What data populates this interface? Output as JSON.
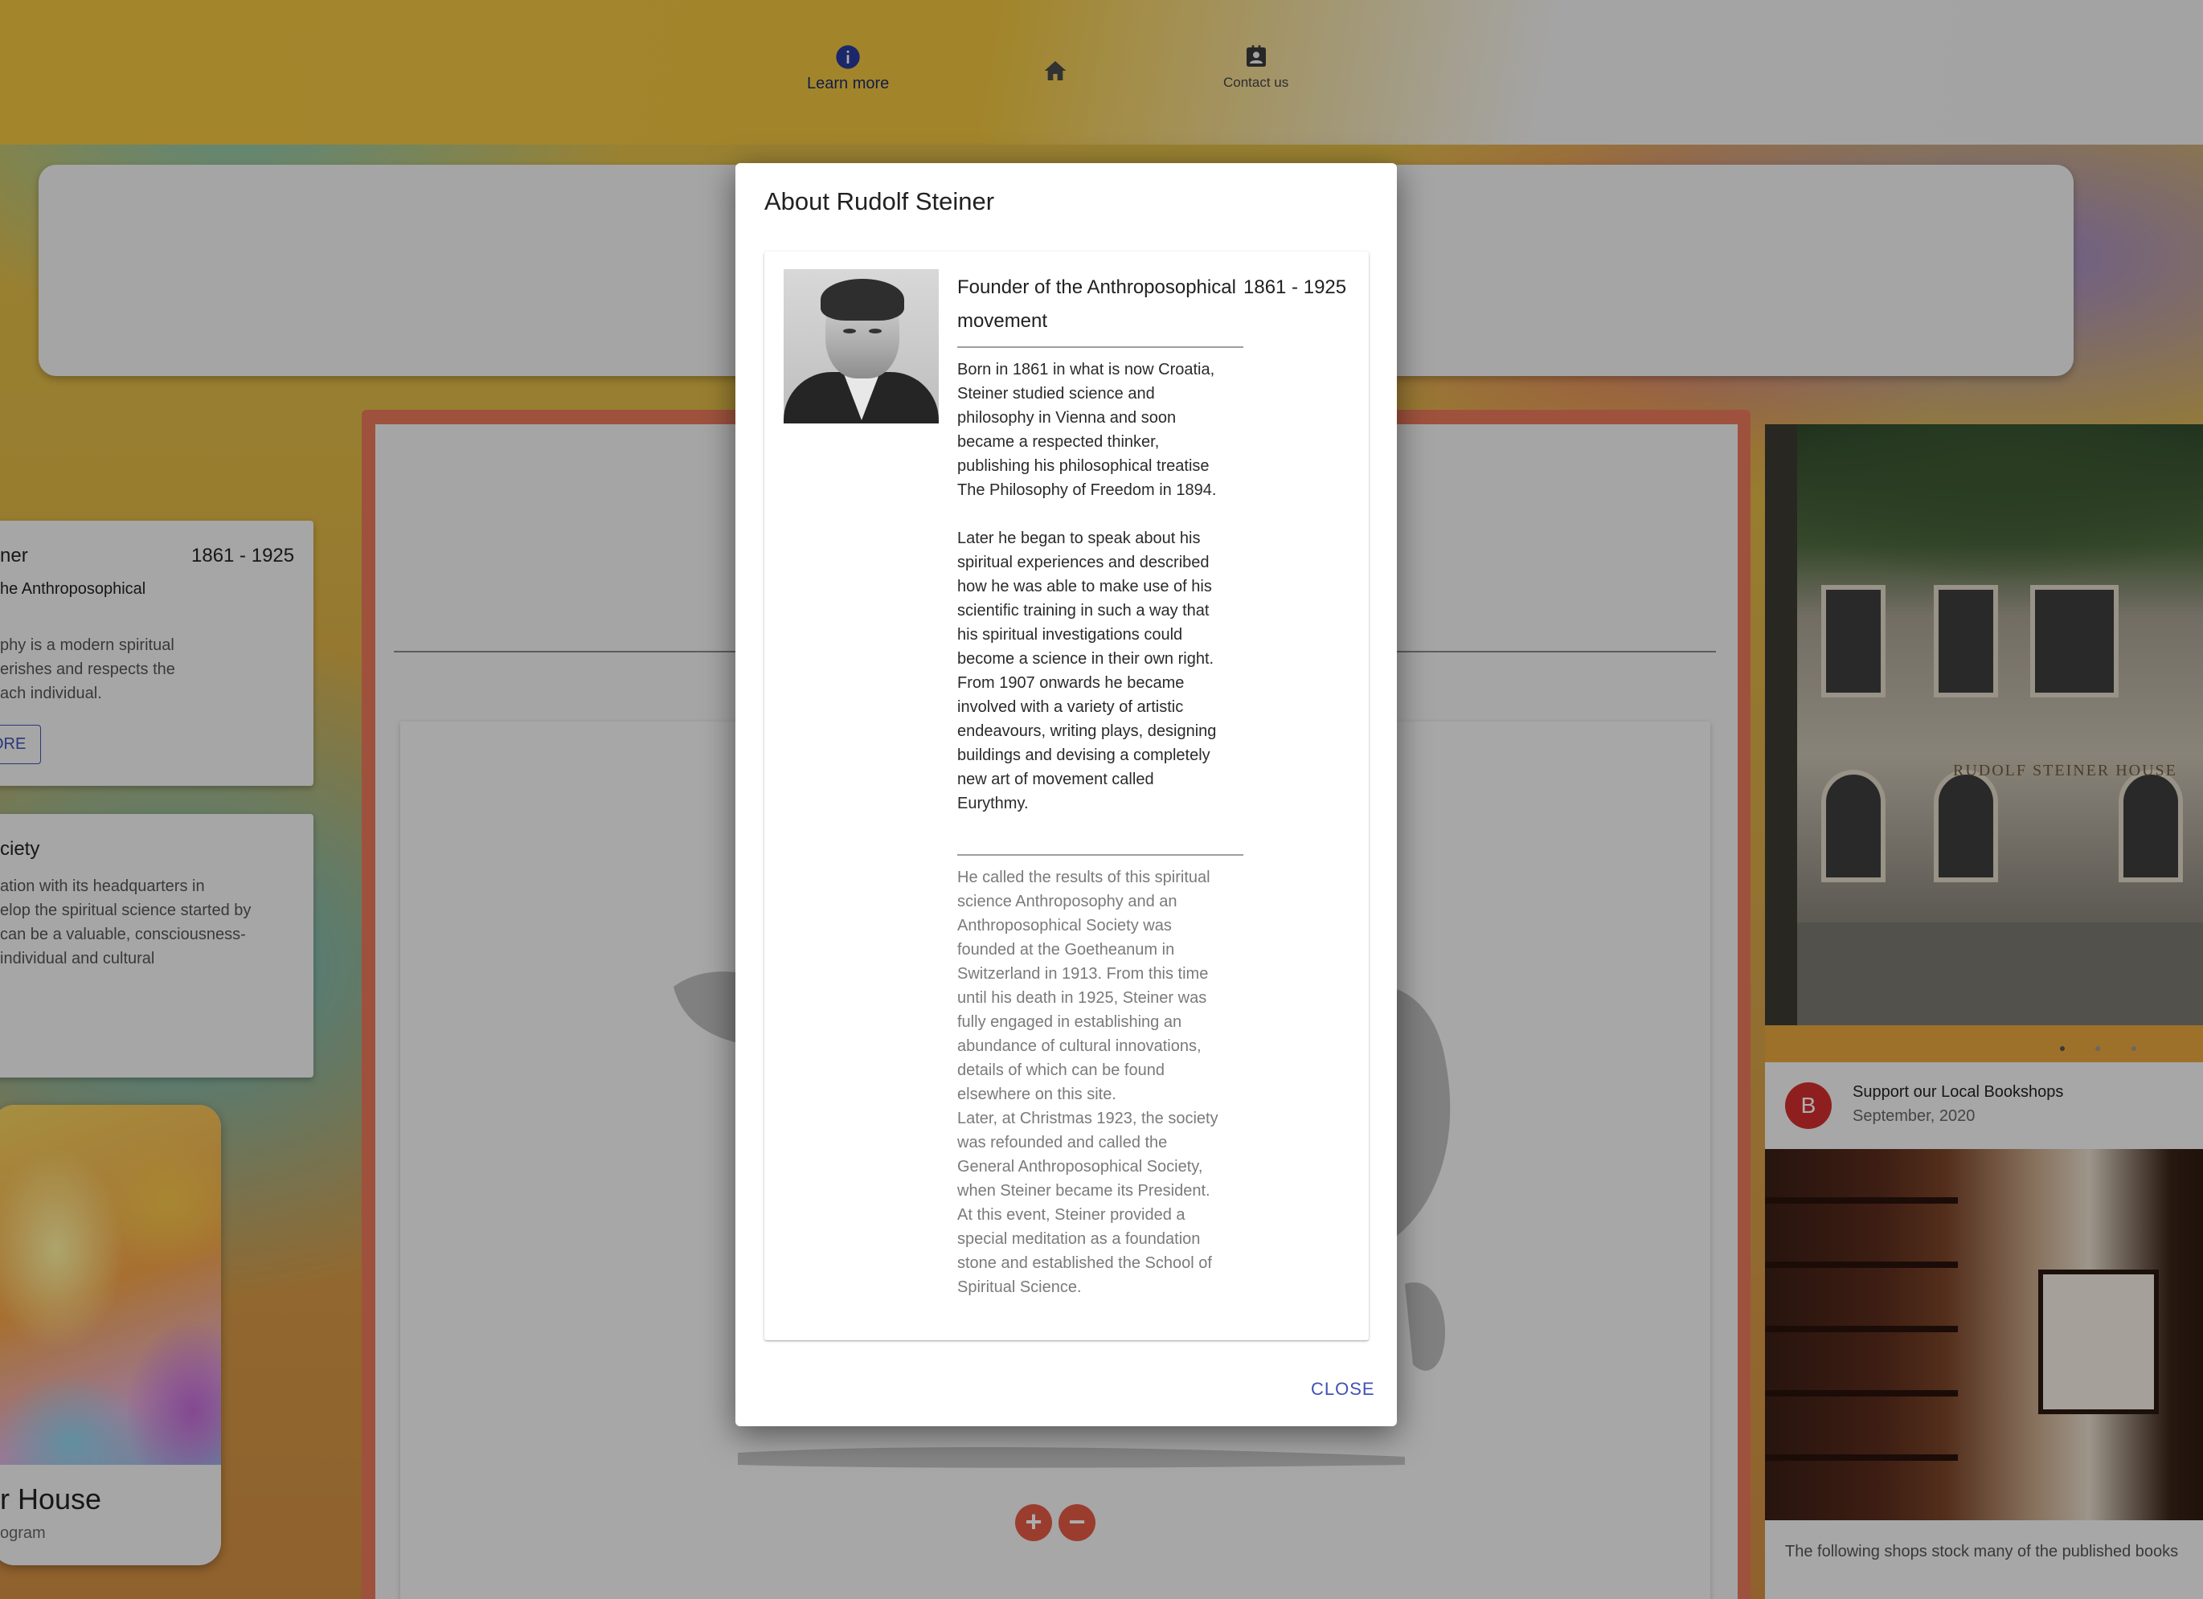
{
  "nav": {
    "items": [
      {
        "label": "Learn more",
        "icon": "info-icon"
      },
      {
        "label": "",
        "icon": "home-icon"
      },
      {
        "label": "Contact us",
        "icon": "contact-card-icon"
      }
    ]
  },
  "background": {
    "side_card_1": {
      "title": "ner",
      "years": "1861 - 1925",
      "subtitle": "he Anthroposophical",
      "text": [
        "phy is a modern spiritual",
        "erishes and respects the",
        "ach individual."
      ],
      "button": "ORE"
    },
    "side_card_2": {
      "title": "ciety",
      "text": [
        "ation with its headquarters in",
        "elop the spiritual science started by",
        "can be a valuable, consciousness-",
        "individual and cultural"
      ]
    },
    "art_card": {
      "title": "r House",
      "subtitle": "ogram"
    },
    "zoom": {
      "plus": "+",
      "minus": "−"
    },
    "building_sign": "RUDOLF STEINER HOUSE",
    "news": {
      "avatar_letter": "B",
      "title": "Support our Local Bookshops",
      "date": "September, 2020",
      "text": "The following shops stock many of the published books"
    }
  },
  "dialog": {
    "title": "About Rudolf Steiner",
    "heading": "Founder of the Anthroposophical movement",
    "years": "1861 - 1925",
    "paragraph_1": "Born in 1861 in what is now Croatia,\nSteiner studied science and\nphilosophy in Vienna and soon\nbecame a respected thinker,\npublishing his philosophical treatise\nThe Philosophy of Freedom in 1894.\n\nLater he began to speak about his\nspiritual experiences and described\nhow he was able to make use of his\nscientific training in such a way that\nhis spiritual investigations could\nbecome a science in their own right.\nFrom 1907 onwards he became\ninvolved with a variety of artistic\nendeavours, writing plays, designing\nbuildings and devising a completely\nnew art of movement called\nEurythmy.",
    "paragraph_2": "He called the results of this spiritual\nscience Anthroposophy and an\nAnthroposophical Society was\nfounded at the Goetheanum in\nSwitzerland in 1913. From this time\nuntil his death in 1925, Steiner was\nfully engaged in establishing an\nabundance of cultural innovations,\ndetails of which can be found\nelsewhere on this site.\nLater, at Christmas 1923, the society\nwas refounded and called the\nGeneral Anthroposophical Society,\nwhen Steiner became its President.\nAt this event, Steiner provided a\nspecial meditation as a foundation\nstone and established the School of\nSpiritual Science.",
    "close_label": "CLOSE"
  },
  "colors": {
    "accent": "#3f51b5",
    "avatar": "#d32f2f",
    "zoom_button": "#e45b44"
  }
}
